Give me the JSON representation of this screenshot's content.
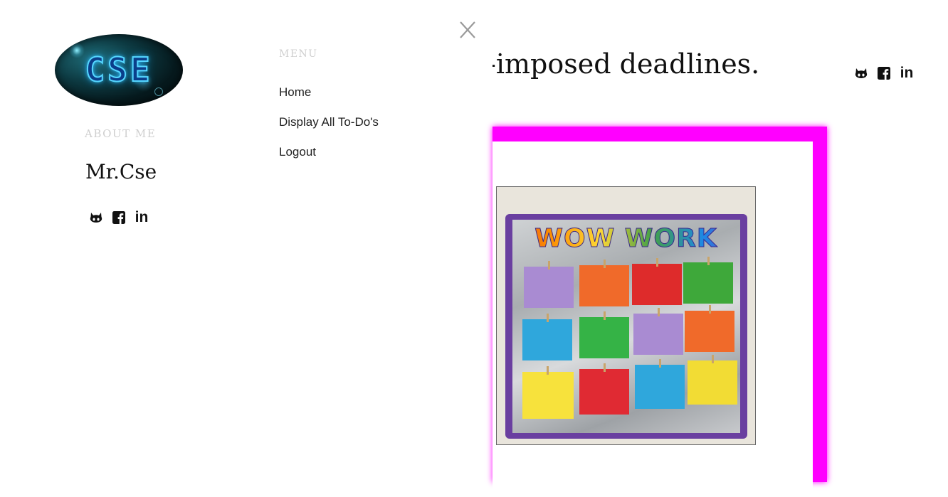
{
  "sidebar": {
    "logo_text": "CSE",
    "about_heading": "ABOUT ME",
    "name": "Mr.Cse",
    "social": [
      {
        "icon": "github-icon"
      },
      {
        "icon": "facebook-icon"
      },
      {
        "icon": "linkedin-icon",
        "text": "in"
      }
    ]
  },
  "menu": {
    "heading": "MENU",
    "items": [
      {
        "label": "Home"
      },
      {
        "label": "Display All To-Do's"
      },
      {
        "label": "Logout"
      }
    ],
    "close_icon": "close-icon"
  },
  "main": {
    "headline": "-imposed deadlines.",
    "image_title": "WOW WORK",
    "social": [
      {
        "icon": "github-icon"
      },
      {
        "icon": "facebook-icon"
      },
      {
        "icon": "linkedin-icon",
        "text": "in"
      }
    ]
  },
  "colors": {
    "accent_frame": "#ff00ff",
    "board_border": "#6a3fa0"
  }
}
